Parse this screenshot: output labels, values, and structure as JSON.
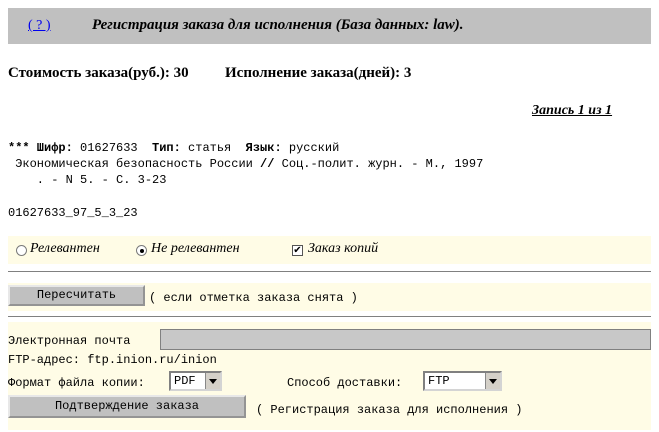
{
  "header": {
    "help_link": "( ? )",
    "title": "Регистрация заказа для исполнения (База данных: law)."
  },
  "summary": {
    "cost_label": "Стоимость заказа(руб.): 30",
    "exec_label": "Исполнение заказа(дней): 3"
  },
  "record_counter": "Запись 1 из 1",
  "record": {
    "cipher_label": "*** Шифр:",
    "cipher_value": " 01627633  ",
    "type_label": "Тип:",
    "type_value": " статья  ",
    "lang_label": "Язык:",
    "lang_value": " русский",
    "line2a": " Экономическая безопасность России ",
    "line2sep": "//",
    "line2b": " Соц.-полит. журн. - М., 1997",
    "line3": "    . - N 5. - С. 3-23",
    "id_line": "01627633_97_5_3_23"
  },
  "options": {
    "relevant": "Релевантен",
    "not_relevant": "Не релевантен",
    "copy_order": "Заказ копий",
    "selected": "not_relevant",
    "copy_checked": true
  },
  "recalc": {
    "button": "Пересчитать",
    "note": "( если отметка заказа снята )"
  },
  "form": {
    "email_label": "Электронная почта",
    "email_value": "",
    "ftp_label": "FTP-адрес: ftp.inion.ru/inion",
    "format_label": "Формат файла копии:",
    "format_value": "PDF",
    "delivery_label": "Способ доставки:",
    "delivery_value": "FTP",
    "confirm_button": "Подтверждение заказа",
    "confirm_note": "( Регистрация заказа для исполнения )"
  }
}
